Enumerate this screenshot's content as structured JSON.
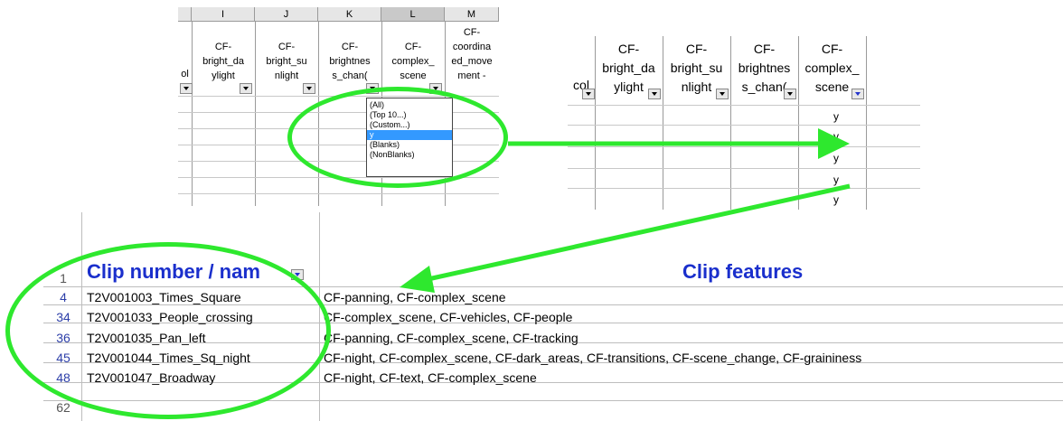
{
  "panel_filter": {
    "col_letters": [
      "I",
      "J",
      "K",
      "L",
      "M"
    ],
    "col_names": [
      "CF-\nbright_da\nylight",
      "CF-\nbright_su\nnlight",
      "CF-\nbrightnes\ns_chan(",
      "CF-\ncomplex_\nscene",
      "CF-\ncoordina\ned_move\nment -"
    ],
    "left_partial": "ol",
    "filter_options": [
      "(All)",
      "(Top 10...)",
      "(Custom...)",
      "y",
      "(Blanks)",
      "(NonBlanks)"
    ],
    "selected_option": "y"
  },
  "panel_result": {
    "col_names": [
      "col",
      "CF-\nbright_da\nylight",
      "CF-\nbright_su\nnlight",
      "CF-\nbrightnes\ns_chan(",
      "CF-\ncomplex_\nscene"
    ],
    "cell_values": [
      "y",
      "y",
      "y",
      "y",
      "y"
    ]
  },
  "sheet": {
    "header_row_num": "1",
    "col1_header": "Clip number / nam",
    "col2_header": "Clip features",
    "rows": [
      {
        "num": "4",
        "name": "T2V001003_Times_Square",
        "features": "CF-panning, CF-complex_scene"
      },
      {
        "num": "34",
        "name": "T2V001033_People_crossing",
        "features": "CF-complex_scene, CF-vehicles, CF-people"
      },
      {
        "num": "36",
        "name": "T2V001035_Pan_left",
        "features": "CF-panning, CF-complex_scene, CF-tracking"
      },
      {
        "num": "45",
        "name": "T2V001044_Times_Sq_night",
        "features": "CF-night, CF-complex_scene, CF-dark_areas, CF-transitions, CF-scene_change, CF-graininess"
      },
      {
        "num": "48",
        "name": "T2V001047_Broadway",
        "features": "CF-night, CF-text, CF-complex_scene"
      }
    ],
    "last_row_num": "62"
  },
  "colors": {
    "annotation": "#2ee82e",
    "header_blue": "#1a2fcc",
    "row_num_blue": "#2c3ea8"
  }
}
